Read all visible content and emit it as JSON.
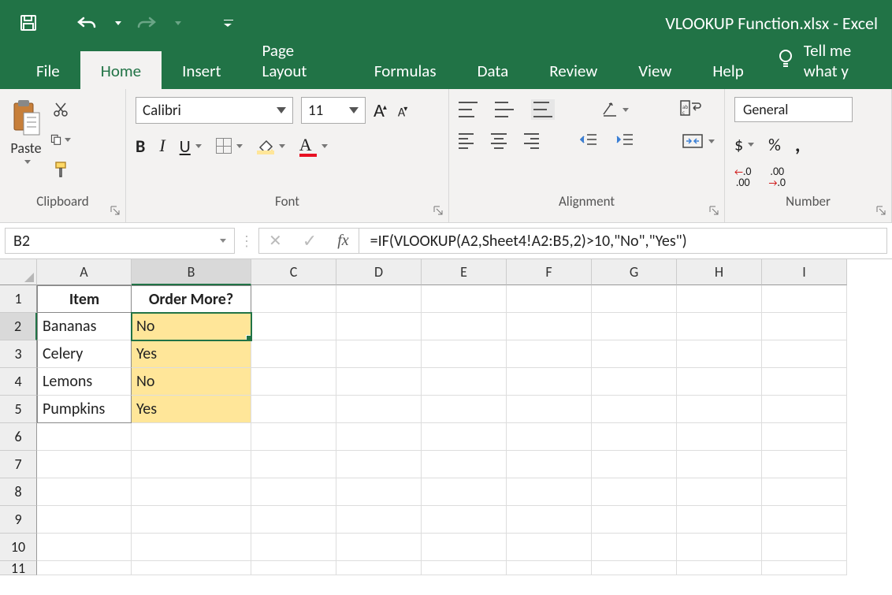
{
  "title": "VLOOKUP Function.xlsx  -  Excel",
  "tabs": {
    "file": "File",
    "home": "Home",
    "insert": "Insert",
    "page_layout": "Page Layout",
    "formulas": "Formulas",
    "data": "Data",
    "review": "Review",
    "view": "View",
    "help": "Help",
    "tellme": "Tell me what y"
  },
  "clipboard": {
    "paste": "Paste",
    "label": "Clipboard"
  },
  "font": {
    "name": "Calibri",
    "size": "11",
    "bold": "B",
    "italic": "I",
    "underline": "U",
    "grow": "A",
    "shrink": "A",
    "label": "Font"
  },
  "alignment": {
    "label": "Alignment"
  },
  "number": {
    "format": "General",
    "currency": "$",
    "percent": "%",
    "comma": ",",
    "inc": ".00",
    "inc2": "←.0",
    "dec": ".00",
    "dec2": "→.0",
    "label": "Number"
  },
  "namebox": "B2",
  "fx": "fx",
  "formula": "=IF(VLOOKUP(A2,Sheet4!A2:B5,2)>10,\"No\",\"Yes\")",
  "cols": [
    "A",
    "B",
    "C",
    "D",
    "E",
    "F",
    "G",
    "H",
    "I"
  ],
  "rows": [
    "1",
    "2",
    "3",
    "4",
    "5",
    "6",
    "7",
    "8",
    "9",
    "10",
    "11"
  ],
  "data": {
    "A1": "Item",
    "B1": "Order More?",
    "A2": "Bananas",
    "B2": "No",
    "A3": "Celery",
    "B3": "Yes",
    "A4": "Lemons",
    "B4": "No",
    "A5": "Pumpkins",
    "B5": "Yes"
  }
}
